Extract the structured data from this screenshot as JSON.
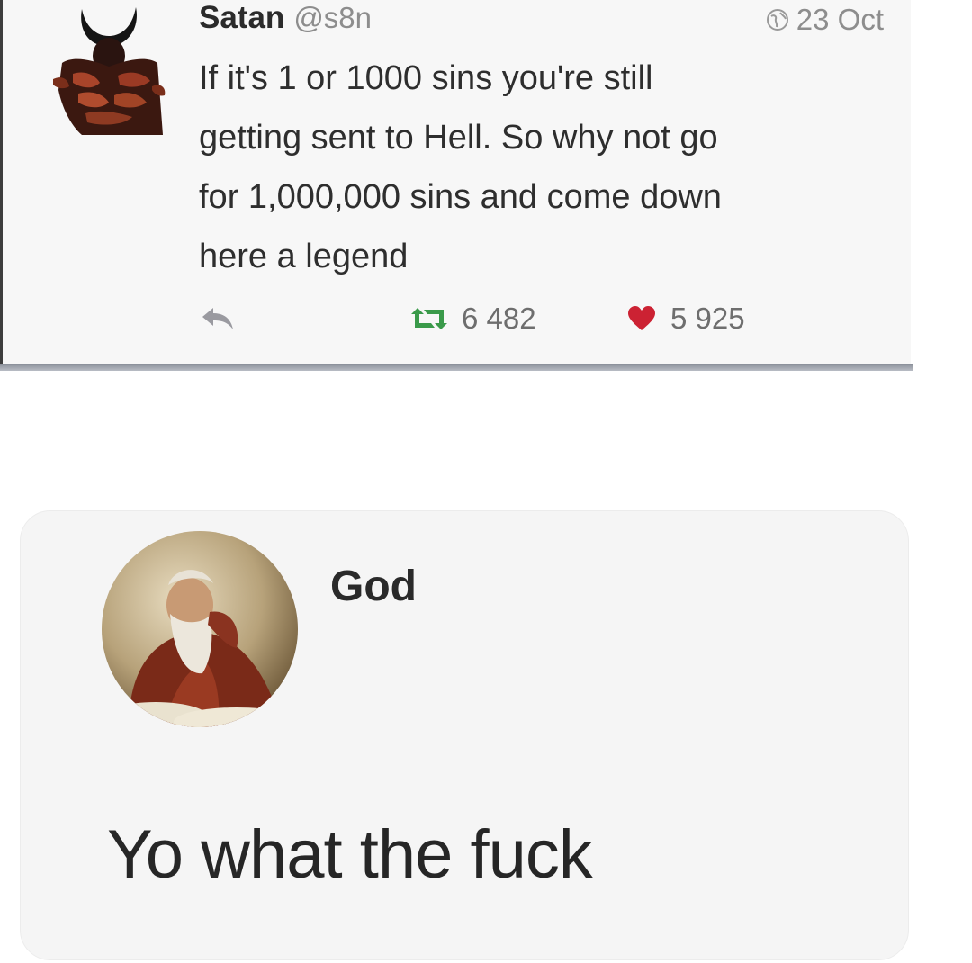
{
  "tweet": {
    "author_name": "Satan",
    "author_handle": "@s8n",
    "date": "23 Oct",
    "text": "If it's 1 or 1000 sins you're still\ngetting sent to Hell. So why not go\nfor 1,000,000 sins and come down\nhere a legend",
    "retweet_count": "6 482",
    "like_count": "5 925",
    "icons": {
      "avatar": "devil-avatar-icon",
      "date": "globe-icon",
      "reply": "reply-icon",
      "retweet": "retweet-icon",
      "like": "heart-icon"
    },
    "colors": {
      "retweet": "#3a9a4a",
      "heart": "#cc2233"
    }
  },
  "reply": {
    "author_name": "God",
    "message": "Yo what the fuck",
    "icons": {
      "avatar": "god-avatar-icon"
    }
  }
}
